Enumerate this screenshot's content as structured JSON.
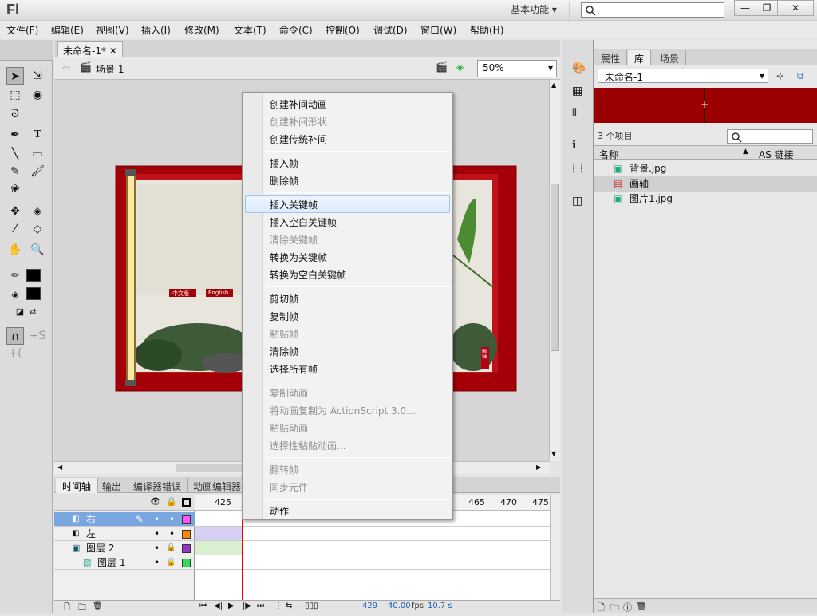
{
  "app": {
    "logo": "Fl",
    "workspace": "基本功能"
  },
  "menu": [
    "文件(F)",
    "编辑(E)",
    "视图(V)",
    "插入(I)",
    "修改(M)",
    "文本(T)",
    "命令(C)",
    "控制(O)",
    "调试(D)",
    "窗口(W)",
    "帮助(H)"
  ],
  "document": {
    "tab_title": "未命名-1*",
    "scene": "场景 1",
    "zoom": "50%"
  },
  "stage": {
    "tag1": "中文版",
    "tag2": "English",
    "seal": "画轴"
  },
  "timeline": {
    "tabs": [
      "时间轴",
      "输出",
      "编译器错误",
      "动画编辑器"
    ],
    "ruler": [
      "425",
      "465",
      "470",
      "475"
    ],
    "layers": [
      {
        "name": "右"
      },
      {
        "name": "左"
      },
      {
        "name": "图层 2"
      },
      {
        "name": "图层 1"
      }
    ],
    "layer_colors": [
      "#ff55ff",
      "#ff8800",
      "#9933cc",
      "#33dd55"
    ],
    "status": {
      "frame": "429",
      "fps": "40.00",
      "fps_unit": "fps",
      "time": "10.7 s"
    }
  },
  "panel": {
    "tabs": [
      "属性",
      "库",
      "场景"
    ],
    "library_name": "未命名-1",
    "item_count": "3 个项目",
    "col_name": "名称",
    "col_link": "AS 链接",
    "items": [
      "背景.jpg",
      "画轴",
      "图片1.jpg"
    ]
  },
  "context_menu": {
    "items": [
      {
        "label": "创建补间动画",
        "disabled": false
      },
      {
        "label": "创建补间形状",
        "disabled": true
      },
      {
        "label": "创建传统补间",
        "disabled": false
      },
      {
        "label": "插入帧",
        "disabled": false
      },
      {
        "label": "删除帧",
        "disabled": false
      },
      {
        "label": "插入关键帧",
        "disabled": false
      },
      {
        "label": "插入空白关键帧",
        "disabled": false
      },
      {
        "label": "清除关键帧",
        "disabled": true
      },
      {
        "label": "转换为关键帧",
        "disabled": false
      },
      {
        "label": "转换为空白关键帧",
        "disabled": false
      },
      {
        "label": "剪切帧",
        "disabled": false
      },
      {
        "label": "复制帧",
        "disabled": false
      },
      {
        "label": "粘贴帧",
        "disabled": true
      },
      {
        "label": "清除帧",
        "disabled": false
      },
      {
        "label": "选择所有帧",
        "disabled": false
      },
      {
        "label": "复制动画",
        "disabled": true
      },
      {
        "label": "将动画复制为 ActionScript 3.0...",
        "disabled": true
      },
      {
        "label": "粘贴动画",
        "disabled": true
      },
      {
        "label": "选择性粘贴动画...",
        "disabled": true
      },
      {
        "label": "翻转帧",
        "disabled": true
      },
      {
        "label": "同步元件",
        "disabled": true
      },
      {
        "label": "动作",
        "disabled": false
      }
    ]
  }
}
